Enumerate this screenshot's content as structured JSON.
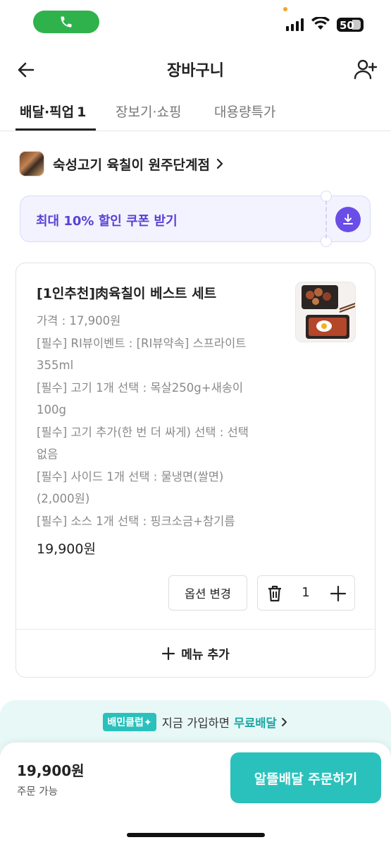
{
  "status_bar": {
    "battery": "50"
  },
  "header": {
    "title": "장바구니"
  },
  "tabs": [
    {
      "label": "배달·픽업",
      "count": "1"
    },
    {
      "label": "장보기·쇼핑"
    },
    {
      "label": "대용량특가"
    }
  ],
  "store": {
    "name": "숙성고기 육칠이 원주단계점"
  },
  "coupon": {
    "text": "최대 10% 할인 쿠폰 받기"
  },
  "cart": {
    "item_name": "[1인추천]肉육칠이 베스트 세트",
    "lines": [
      "가격 : 17,900원",
      "[필수] RI뷰이벤트 : [RI뷰약속] 스프라이트",
      "355ml",
      "[필수] 고기 1개 선택 : 목살250g+새송이",
      "100g",
      "[필수] 고기 추가(한 번 더 싸게) 선택 : 선택",
      "없음",
      "[필수] 사이드 1개 선택 : 물냉면(쌀면)",
      "(2,000원)",
      "[필수] 소스 1개 선택 : 핑크소금+참기름"
    ],
    "item_total": "19,900원",
    "option_button": "옵션 변경",
    "quantity": "1",
    "add_menu": "메뉴 추가"
  },
  "promo": {
    "badge": "배민클럽✦",
    "text": "지금 가입하면",
    "highlight": "무료배달"
  },
  "order": {
    "total": "19,900원",
    "status": "주문 가능",
    "button": "알뜰배달 주문하기"
  },
  "colors": {
    "accent": "#2ac1bc",
    "coupon": "#5b40d6"
  }
}
